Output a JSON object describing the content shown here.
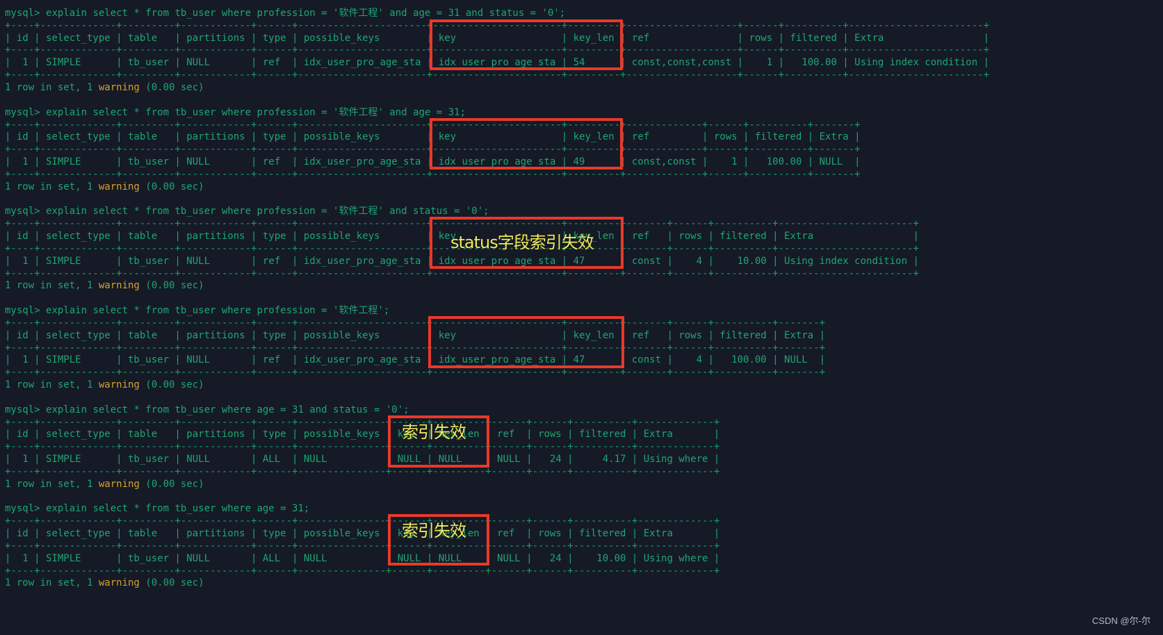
{
  "terminal": {
    "prompt": "mysql> ",
    "columns": [
      "id",
      "select_type",
      "table",
      "partitions",
      "type",
      "possible_keys",
      "key",
      "key_len",
      "ref",
      "rows",
      "filtered",
      "Extra"
    ],
    "result_line": {
      "prefix": "1 row in set, 1 ",
      "warning_word": "warning",
      "suffix": " (0.00 sec)"
    },
    "queries": [
      {
        "command": "explain select * from tb_user where profession = '软件工程' and age = 31 and status = '0';",
        "row": [
          "1",
          "SIMPLE",
          "tb_user",
          "NULL",
          "ref",
          "idx_user_pro_age_sta",
          "idx_user_pro_age_sta",
          "54",
          "const,const,const",
          "1",
          "100.00",
          "Using index condition"
        ],
        "annotation": ""
      },
      {
        "command": "explain select * from tb_user where profession = '软件工程' and age = 31;",
        "row": [
          "1",
          "SIMPLE",
          "tb_user",
          "NULL",
          "ref",
          "idx_user_pro_age_sta",
          "idx_user_pro_age_sta",
          "49",
          "const,const",
          "1",
          "100.00",
          "NULL"
        ],
        "annotation": ""
      },
      {
        "command": "explain select * from tb_user where profession = '软件工程' and status = '0';",
        "row": [
          "1",
          "SIMPLE",
          "tb_user",
          "NULL",
          "ref",
          "idx_user_pro_age_sta",
          "idx_user_pro_age_sta",
          "47",
          "const",
          "4",
          "10.00",
          "Using index condition"
        ],
        "annotation": "status字段索引失效"
      },
      {
        "command": "explain select * from tb_user where profession = '软件工程';",
        "row": [
          "1",
          "SIMPLE",
          "tb_user",
          "NULL",
          "ref",
          "idx_user_pro_age_sta",
          "idx_user_pro_age_sta",
          "47",
          "const",
          "4",
          "100.00",
          "NULL"
        ],
        "annotation": ""
      },
      {
        "command": "explain select * from tb_user where age = 31 and status = '0';",
        "row": [
          "1",
          "SIMPLE",
          "tb_user",
          "NULL",
          "ALL",
          "NULL",
          "NULL",
          "NULL",
          "NULL",
          "24",
          "4.17",
          "Using where"
        ],
        "annotation": "索引失效"
      },
      {
        "command": "explain select * from tb_user where age = 31;",
        "row": [
          "1",
          "SIMPLE",
          "tb_user",
          "NULL",
          "ALL",
          "NULL",
          "NULL",
          "NULL",
          "NULL",
          "24",
          "10.00",
          "Using where"
        ],
        "annotation": "索引失效"
      }
    ]
  },
  "colors": {
    "background": "#151a26",
    "text": "#1ea672",
    "warning": "#d9a22b",
    "highlight_box": "#e8392a",
    "annotation": "#f1ec5e"
  },
  "watermark": "CSDN @尔-尔"
}
